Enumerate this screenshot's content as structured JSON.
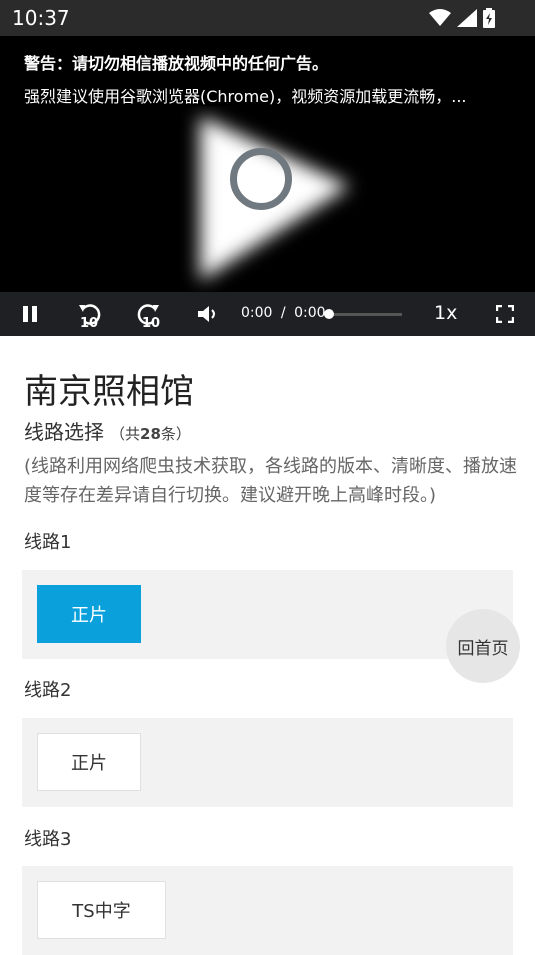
{
  "status_bar": {
    "time": "10:37"
  },
  "player": {
    "notice_warning": "警告：请切勿相信播放视频中的任何广告。",
    "notice_browser": "强烈建议使用谷歌浏览器(Chrome)，视频资源加载更流畅，...",
    "current_time": "0:00",
    "separator": "/",
    "duration": "0:00",
    "progress": 0,
    "playback_rate": "1x",
    "rewind_seconds": "10",
    "forward_seconds": "10"
  },
  "page": {
    "title": "南京照相馆",
    "route_select_label": "线路选择",
    "route_count_prefix": "（共",
    "route_count": "28",
    "route_count_suffix": "条）",
    "description": "(线路利用网络爬虫技术获取，各线路的版本、清晰度、播放速度等存在差异请自行切换。建议避开晚上高峰时段。)"
  },
  "routes": [
    {
      "label": "线路1",
      "episode": "正片",
      "active": true
    },
    {
      "label": "线路2",
      "episode": "正片",
      "active": false
    },
    {
      "label": "线路3",
      "episode": "TS中字",
      "active": false
    }
  ],
  "home_button": "回首页",
  "colors": {
    "accent": "#0aa0dc",
    "player_bg": "#000000",
    "controls_bg": "#1f2023"
  },
  "icons": [
    "wifi-icon",
    "cell-signal-icon",
    "battery-icon",
    "play-icon",
    "loading-spinner-icon",
    "pause-icon",
    "rewind-10-icon",
    "forward-10-icon",
    "volume-icon",
    "fullscreen-icon"
  ]
}
